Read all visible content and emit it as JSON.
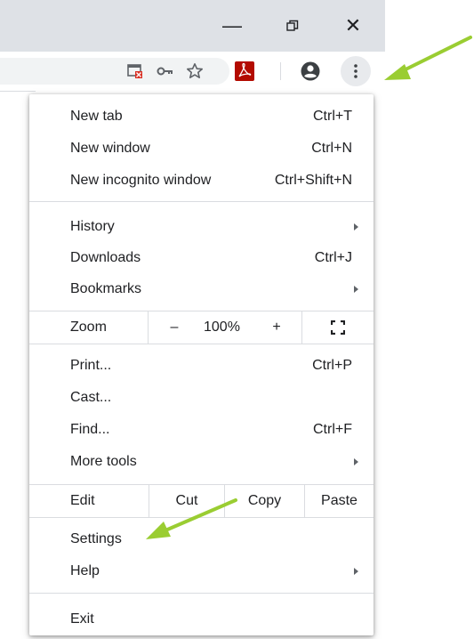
{
  "window": {
    "minimize_glyph": "—",
    "restore_glyph": "⧉",
    "close_glyph": "✕"
  },
  "toolbar": {
    "icons": [
      "install-app-icon",
      "key-icon",
      "star-icon",
      "acrobat-icon",
      "profile-icon",
      "kebab-menu-icon"
    ]
  },
  "menu": {
    "new_tab": {
      "label": "New tab",
      "shortcut": "Ctrl+T"
    },
    "new_window": {
      "label": "New window",
      "shortcut": "Ctrl+N"
    },
    "new_incognito": {
      "label": "New incognito window",
      "shortcut": "Ctrl+Shift+N"
    },
    "history": {
      "label": "History"
    },
    "downloads": {
      "label": "Downloads",
      "shortcut": "Ctrl+J"
    },
    "bookmarks": {
      "label": "Bookmarks"
    },
    "zoom": {
      "label": "Zoom",
      "minus": "–",
      "value": "100%",
      "plus": "+"
    },
    "print": {
      "label": "Print...",
      "shortcut": "Ctrl+P"
    },
    "cast": {
      "label": "Cast..."
    },
    "find": {
      "label": "Find...",
      "shortcut": "Ctrl+F"
    },
    "more_tools": {
      "label": "More tools"
    },
    "edit": {
      "label": "Edit",
      "cut": "Cut",
      "copy": "Copy",
      "paste": "Paste"
    },
    "settings": {
      "label": "Settings"
    },
    "help": {
      "label": "Help"
    },
    "exit": {
      "label": "Exit"
    }
  },
  "colors": {
    "titlebar": "#dee1e6",
    "arrow": "#9acd32",
    "acrobat": "#b30b00"
  }
}
